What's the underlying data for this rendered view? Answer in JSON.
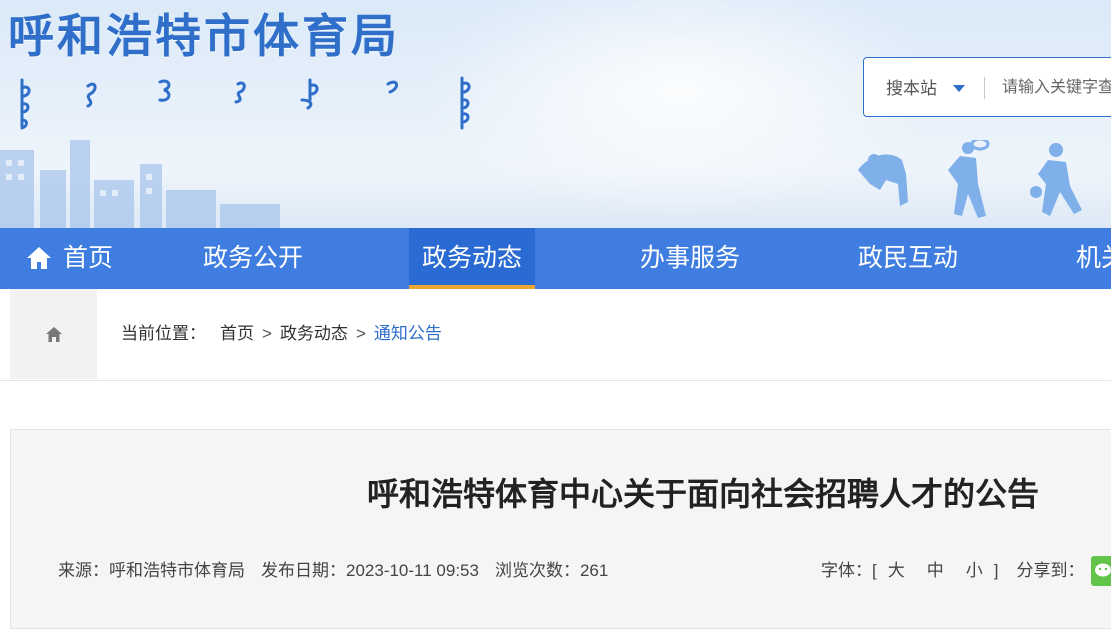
{
  "header": {
    "site_title": "呼和浩特市体育局",
    "search": {
      "scope_label": "搜本站",
      "placeholder": "请输入关键字查"
    }
  },
  "nav": {
    "items": [
      {
        "label": "首页"
      },
      {
        "label": "政务公开"
      },
      {
        "label": "政务动态"
      },
      {
        "label": "办事服务"
      },
      {
        "label": "政民互动"
      },
      {
        "label": "机关"
      }
    ],
    "active_index": 2
  },
  "breadcrumb": {
    "label": "当前位置：",
    "items": [
      "首页",
      "政务动态",
      "通知公告"
    ],
    "separator": ">"
  },
  "article": {
    "title": "呼和浩特体育中心关于面向社会招聘人才的公告",
    "source_label": "来源：",
    "source": "呼和浩特市体育局",
    "date_label": "发布日期：",
    "date": "2023-10-11 09:53",
    "views_label": "浏览次数：",
    "views": "261",
    "font_label": "字体：",
    "bracket_open": "[",
    "bracket_close": "]",
    "font_sizes": [
      "大",
      "中",
      "小"
    ],
    "share_label": "分享到："
  },
  "colors": {
    "brand_blue": "#2f6fca",
    "nav_bg": "#3f7ee0",
    "nav_active_underline": "#f0a530",
    "wechat_green": "#62c448"
  }
}
